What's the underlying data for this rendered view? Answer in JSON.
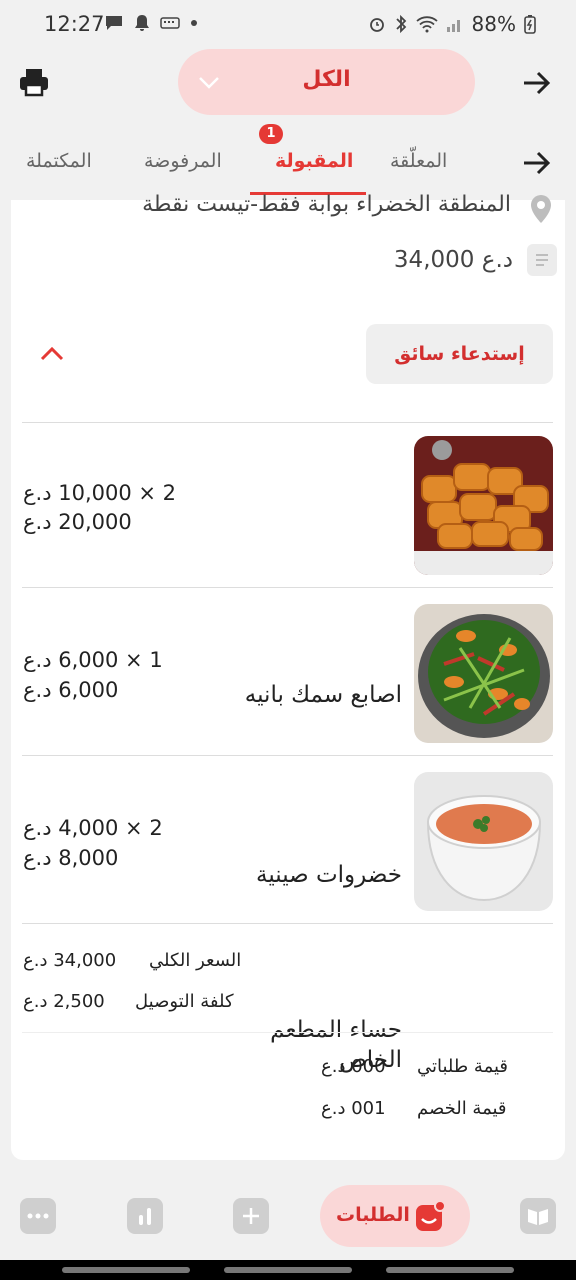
{
  "status_bar": {
    "time": "12:27",
    "battery": "88%"
  },
  "header": {
    "filter_label": "الكل"
  },
  "tabs": [
    {
      "label": "المكتملة"
    },
    {
      "label": "المرفوضة"
    },
    {
      "label": "المقبولة",
      "badge": "1",
      "active": true
    },
    {
      "label": "المعلّقة"
    }
  ],
  "order": {
    "address": "المنطقة الخضراء بوابة فقط-تيست نقطة",
    "total": "34,000 د.ع",
    "call_driver": "إستدعاء سائق",
    "items": [
      {
        "name": "اصابع سمك بانيه",
        "qty_line": "2 × 10,000 د.ع",
        "sum": "20,000 د.ع",
        "image": "fish-fingers"
      },
      {
        "name": "خضروات صينية",
        "qty_line": "1 × 6,000 د.ع",
        "sum": "6,000 د.ع",
        "image": "vegetables"
      },
      {
        "name": "حساء المطعم الخاص",
        "qty_line": "2 × 4,000 د.ع",
        "sum": "8,000 د.ع",
        "image": "soup"
      }
    ],
    "summary": {
      "total_label": "السعر الكلي",
      "total_value": "34,000 د.ع",
      "delivery_label": "كلفة التوصيل",
      "delivery_value": "2,500 د.ع",
      "my_orders_label": "قيمة طلباتي",
      "my_orders_value": "000 د.ع",
      "discount_label": "قيمة الخصم",
      "discount_value": "001 د.ع"
    }
  },
  "bottom_nav": {
    "orders_label": "الطلبات"
  },
  "colors": {
    "accent": "#e53935",
    "accent_soft": "#fad7d7"
  }
}
